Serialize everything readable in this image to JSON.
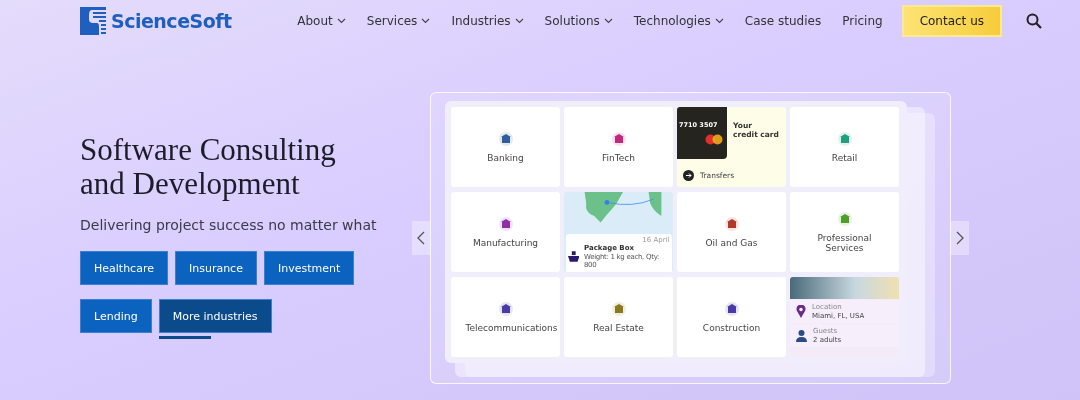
{
  "header": {
    "logo": "ScienceSoft",
    "nav": [
      {
        "label": "About",
        "dropdown": true
      },
      {
        "label": "Services",
        "dropdown": true
      },
      {
        "label": "Industries",
        "dropdown": true
      },
      {
        "label": "Solutions",
        "dropdown": true
      },
      {
        "label": "Technologies",
        "dropdown": true
      },
      {
        "label": "Case studies",
        "dropdown": false
      },
      {
        "label": "Pricing",
        "dropdown": false
      }
    ],
    "cta": "Contact us"
  },
  "hero": {
    "title": "Software Consulting and Development",
    "subtitle": "Delivering project success no matter what",
    "buttons": [
      {
        "label": "Healthcare",
        "kind": "industry"
      },
      {
        "label": "Insurance",
        "kind": "industry"
      },
      {
        "label": "Investment",
        "kind": "industry"
      },
      {
        "label": "Lending",
        "kind": "industry"
      },
      {
        "label": "More industries",
        "kind": "more"
      }
    ]
  },
  "showcase": {
    "tiles": [
      {
        "kind": "industry",
        "label": "Banking",
        "color": "#2f5d9e"
      },
      {
        "kind": "industry",
        "label": "FinTech",
        "color": "#c2287a"
      },
      {
        "kind": "card",
        "number": "7710 3507",
        "title": "Your credit card",
        "action": "Transfers"
      },
      {
        "kind": "industry",
        "label": "Retail",
        "color": "#1f9e80"
      },
      {
        "kind": "industry",
        "label": "Manufacturing",
        "color": "#8e2fa8"
      },
      {
        "kind": "map",
        "date": "16 April",
        "title": "Package Box",
        "detail": "Weight: 1 kg each, Qty: 800"
      },
      {
        "kind": "industry",
        "label": "Oil and Gas",
        "color": "#b0392a"
      },
      {
        "kind": "industry",
        "label": "Professional Services",
        "color": "#4e9e2a"
      },
      {
        "kind": "industry",
        "label": "Telecommunications",
        "color": "#4a3aa8"
      },
      {
        "kind": "industry",
        "label": "Real Estate",
        "color": "#8a7a1a"
      },
      {
        "kind": "industry",
        "label": "Construction",
        "color": "#4a3aa8"
      },
      {
        "kind": "travel",
        "location_label": "Location",
        "location": "Miami, FL, USA",
        "guests_label": "Guests",
        "guests": "2 adults"
      }
    ]
  }
}
